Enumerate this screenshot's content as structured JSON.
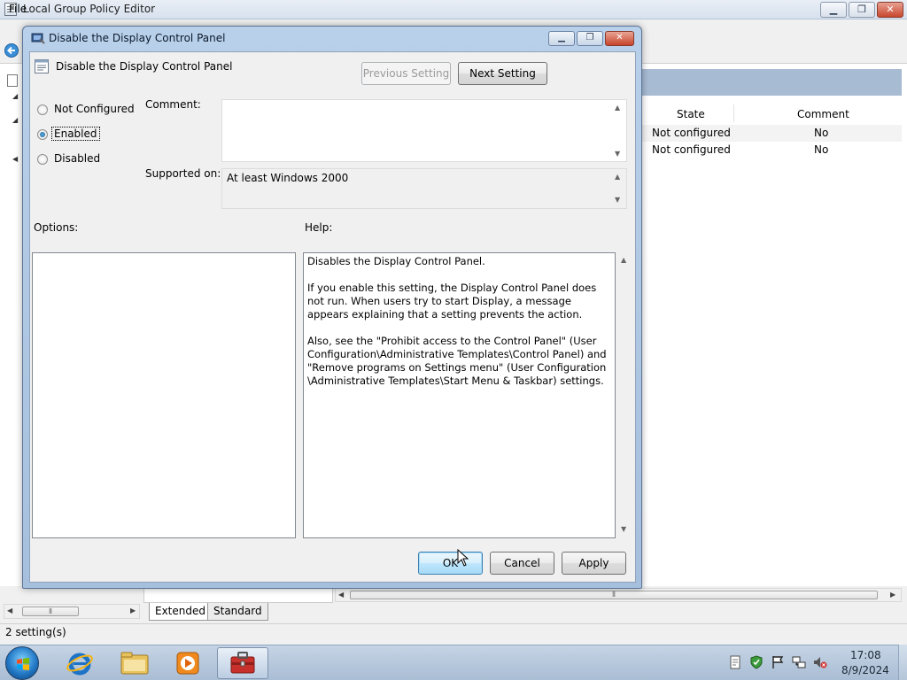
{
  "main_window": {
    "title": "Local Group Policy Editor",
    "menu_file": "File",
    "minimize_glyph": "▁",
    "restore_glyph": "❐",
    "close_glyph": "✕"
  },
  "right_pane": {
    "columns": {
      "state": "State",
      "comment": "Comment"
    },
    "rows": [
      {
        "state": "Not configured",
        "comment": "No"
      },
      {
        "state": "Not configured",
        "comment": "No"
      }
    ]
  },
  "tabs": {
    "extended": "Extended",
    "standard": "Standard"
  },
  "status_bar": {
    "text": "2 setting(s)"
  },
  "dialog": {
    "title": "Disable the Display Control Panel",
    "setting_name": "Disable the Display Control Panel",
    "prev_button": "Previous Setting",
    "next_button": "Next Setting",
    "radio": {
      "not_configured": "Not Configured",
      "enabled": "Enabled",
      "disabled": "Disabled",
      "selected": "enabled"
    },
    "comment_label": "Comment:",
    "comment_value": "",
    "supported_label": "Supported on:",
    "supported_value": "At least Windows 2000",
    "options_label": "Options:",
    "help_label": "Help:",
    "help_text": "Disables the Display Control Panel.\n\nIf you enable this setting, the Display Control Panel does not run. When users try to start Display, a message appears explaining that a setting prevents the action.\n\nAlso, see the \"Prohibit access to the Control Panel\" (User Configuration\\Administrative Templates\\Control Panel) and \"Remove programs on Settings menu\" (User Configuration \\Administrative Templates\\Start Menu & Taskbar) settings.",
    "ok_button": "OK",
    "cancel_button": "Cancel",
    "apply_button": "Apply"
  },
  "taskbar": {
    "clock_time": "17:08",
    "clock_date": "8/9/2024",
    "icons": [
      "start-orb-icon",
      "internet-explorer-icon",
      "windows-explorer-icon",
      "media-player-icon",
      "group-policy-editor-icon"
    ],
    "tray_icons": [
      "notes-icon",
      "security-shield-icon",
      "action-center-flag-icon",
      "network-icon",
      "volume-muted-icon"
    ]
  },
  "colors": {
    "title_bar": "#b9d0ea",
    "default_button": "#3c7fb1",
    "list_header_band": "#a7bbd3",
    "taskbar": "#a9bdd4"
  }
}
